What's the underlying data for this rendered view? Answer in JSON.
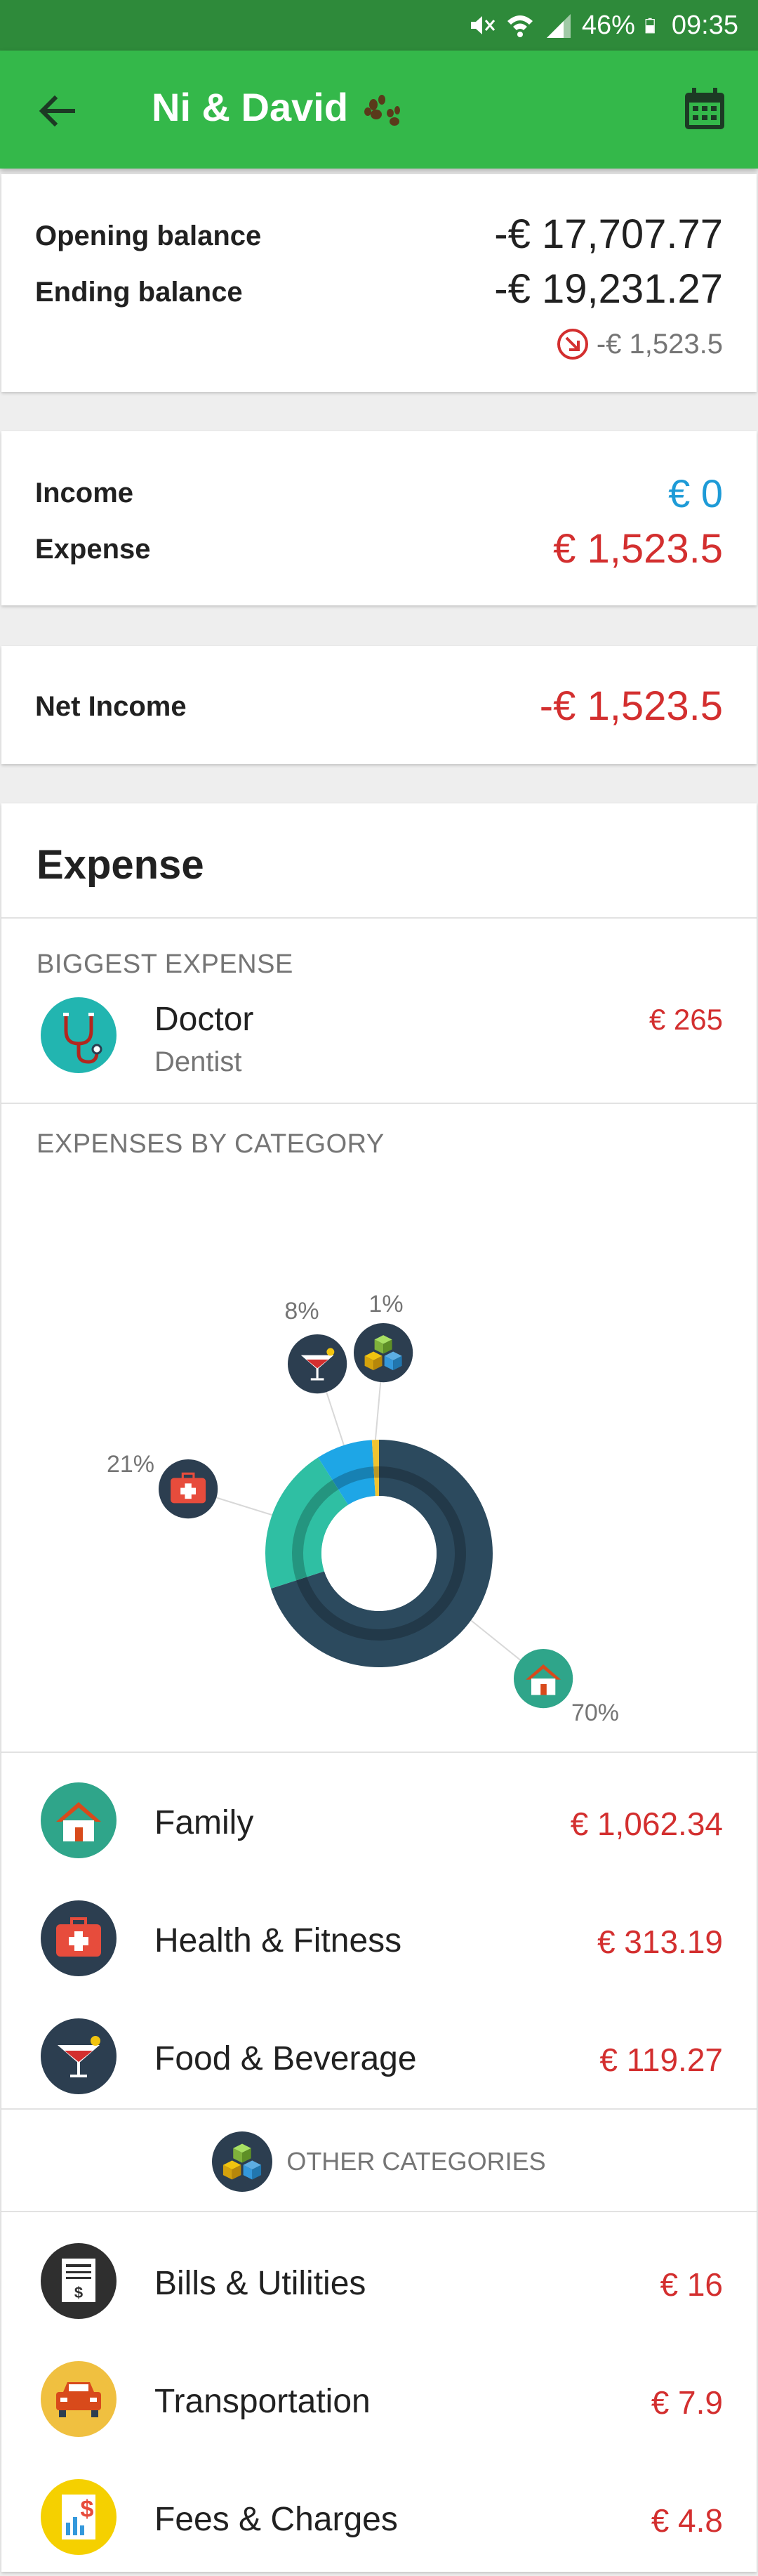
{
  "status_bar": {
    "battery": "46%",
    "time": "09:35",
    "icons": [
      "mute-icon",
      "wifi-icon",
      "signal-icon",
      "battery-icon"
    ]
  },
  "app_bar": {
    "title": "Ni & David",
    "back_icon": "arrow-left-icon",
    "calendar_icon": "calendar-icon",
    "title_emoji": "paw-prints"
  },
  "balance": {
    "opening_label": "Opening balance",
    "opening_value": "-€ 17,707.77",
    "ending_label": "Ending balance",
    "ending_value": "-€ 19,231.27",
    "change_value": "-€ 1,523.5",
    "change_icon": "arrow-down-right-icon"
  },
  "totals": {
    "income_label": "Income",
    "income_value": "€ 0",
    "expense_label": "Expense",
    "expense_value": "€ 1,523.5"
  },
  "net": {
    "label": "Net Income",
    "value": "-€ 1,523.5"
  },
  "expense": {
    "title": "Expense",
    "biggest_header": "BIGGEST EXPENSE",
    "biggest": {
      "name": "Doctor",
      "sub": "Dentist",
      "amount": "€ 265",
      "icon": "stethoscope-icon"
    },
    "by_category_header": "EXPENSES BY CATEGORY",
    "chart_data": {
      "type": "pie",
      "categories": [
        "Family",
        "Health & Fitness",
        "Food & Beverage",
        "Other categories"
      ],
      "values": [
        70,
        21,
        8,
        1
      ],
      "labels": [
        "70%",
        "21%",
        "8%",
        "1%"
      ],
      "colors": [
        "#2c4a5e",
        "#2fbfa3",
        "#1ea6e6",
        "#f0c330"
      ],
      "icons": [
        "house-icon",
        "first-aid-kit-icon",
        "cocktail-icon",
        "cubes-icon"
      ]
    },
    "categories": [
      {
        "name": "Family",
        "amount": "€ 1,062.34",
        "icon": "house-icon"
      },
      {
        "name": "Health & Fitness",
        "amount": "€ 313.19",
        "icon": "first-aid-kit-icon"
      },
      {
        "name": "Food & Beverage",
        "amount": "€ 119.27",
        "icon": "cocktail-icon"
      }
    ],
    "other_header": "OTHER CATEGORIES",
    "other_icon": "cubes-icon",
    "other_categories": [
      {
        "name": "Bills & Utilities",
        "amount": "€ 16",
        "icon": "bill-icon"
      },
      {
        "name": "Transportation",
        "amount": "€ 7.9",
        "icon": "car-icon"
      },
      {
        "name": "Fees & Charges",
        "amount": "€ 4.8",
        "icon": "fees-icon"
      }
    ]
  }
}
